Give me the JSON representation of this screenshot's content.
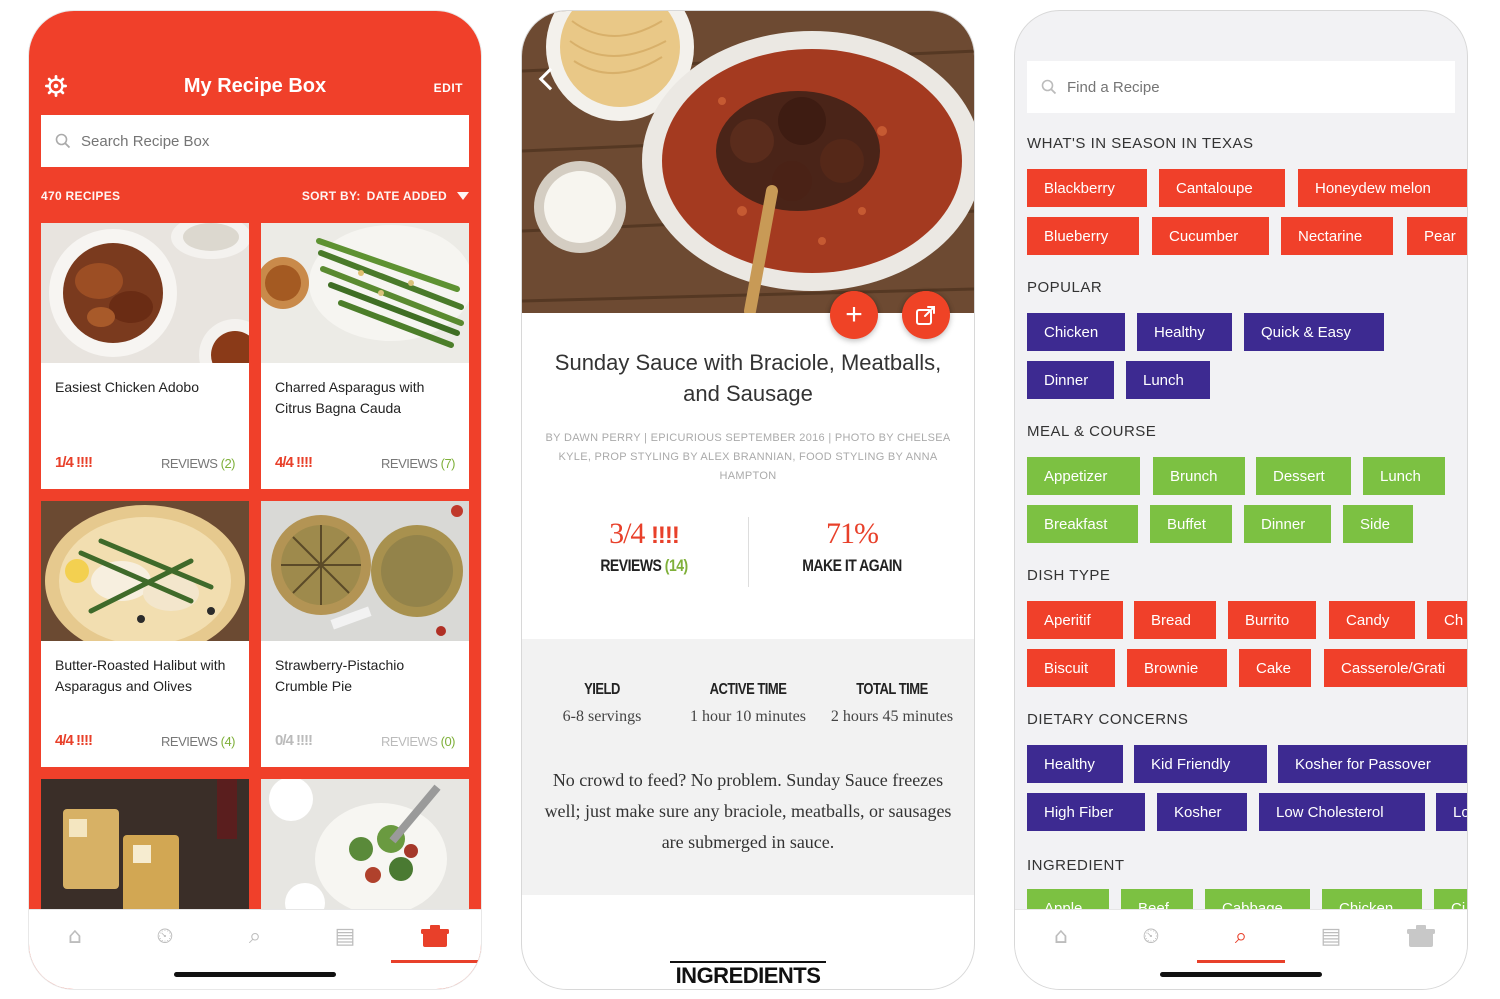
{
  "phone1": {
    "title": "My Recipe Box",
    "edit_label": "EDIT",
    "search_placeholder": "Search Recipe Box",
    "recipe_count": "470 RECIPES",
    "sort_label": "SORT BY:",
    "sort_value": "DATE ADDED",
    "cards": [
      {
        "name": "Easiest Chicken Adobo",
        "rating": "1/4",
        "forks": "!!!!",
        "reviews_label": "REVIEWS",
        "reviews_count": "(2)",
        "dim": false
      },
      {
        "name": "Charred Asparagus with Citrus Bagna Cauda",
        "rating": "4/4",
        "forks": "!!!!",
        "reviews_label": "REVIEWS",
        "reviews_count": "(7)",
        "dim": false
      },
      {
        "name": "Butter-Roasted Halibut with Asparagus and Olives",
        "rating": "4/4",
        "forks": "!!!!",
        "reviews_label": "REVIEWS",
        "reviews_count": "(4)",
        "dim": false
      },
      {
        "name": "Strawberry-Pistachio Crumble Pie",
        "rating": "0/4",
        "forks": "!!!!",
        "reviews_label": "REVIEWS",
        "reviews_count": "(0)",
        "dim": true
      }
    ],
    "tabs": [
      "home-icon",
      "timer-icon",
      "search-icon",
      "list-icon",
      "recipe-box-icon"
    ],
    "active_tab": 4
  },
  "phone2": {
    "title": "Sunday Sauce with Braciole, Meatballs, and Sausage",
    "byline": "BY DAWN PERRY | EPICURIOUS SEPTEMBER 2016 | PHOTO BY CHELSEA KYLE, PROP STYLING BY ALEX BRANNIAN, FOOD STYLING BY ANNA HAMPTON",
    "rating": "3/4",
    "forks": "!!!!",
    "reviews_label": "REVIEWS",
    "reviews_count": "(14)",
    "make_again_pct": "71%",
    "make_again_label": "MAKE IT AGAIN",
    "yield_label": "YIELD",
    "yield_value": "6-8 servings",
    "active_label": "ACTIVE TIME",
    "active_value": "1 hour 10 minutes",
    "total_label": "TOTAL TIME",
    "total_value": "2 hours 45 minutes",
    "description": "No crowd to feed? No problem. Sunday Sauce freezes well; just make sure any braciole, meatballs, or sausages are submerged in sauce.",
    "ingredients_label": "INGREDIENTS",
    "add_symbol": "+",
    "colors": {
      "accent": "#ef4326",
      "green": "#7fb03a"
    }
  },
  "phone3": {
    "search_placeholder": "Find a Recipe",
    "sections": {
      "season": {
        "title": "WHAT'S IN SEASON IN TEXAS",
        "chips": [
          "Blackberry",
          "Cantaloupe",
          "Honeydew melon",
          "Blueberry",
          "Cucumber",
          "Nectarine",
          "Pear"
        ]
      },
      "popular": {
        "title": "POPULAR",
        "chips": [
          "Chicken",
          "Healthy",
          "Quick & Easy",
          "Dinner",
          "Lunch"
        ]
      },
      "meal": {
        "title": "MEAL & COURSE",
        "chips": [
          "Appetizer",
          "Brunch",
          "Dessert",
          "Lunch",
          "Breakfast",
          "Buffet",
          "Dinner",
          "Side"
        ]
      },
      "dish": {
        "title": "DISH TYPE",
        "chips": [
          "Aperitif",
          "Bread",
          "Burrito",
          "Candy",
          "Ch",
          "Biscuit",
          "Brownie",
          "Cake",
          "Casserole/Grati"
        ]
      },
      "diet": {
        "title": "DIETARY CONCERNS",
        "chips": [
          "Healthy",
          "Kid Friendly",
          "Kosher for Passover",
          "High Fiber",
          "Kosher",
          "Low Cholesterol",
          "Lo"
        ]
      },
      "ingredient": {
        "title": "INGREDIENT",
        "chips": [
          "Apple",
          "Beef",
          "Cabbage",
          "Chicken",
          "Ci"
        ]
      }
    },
    "active_tab": 2,
    "colors": {
      "red": "#f0402a",
      "purple": "#3d2a91",
      "green": "#7cc142"
    }
  }
}
